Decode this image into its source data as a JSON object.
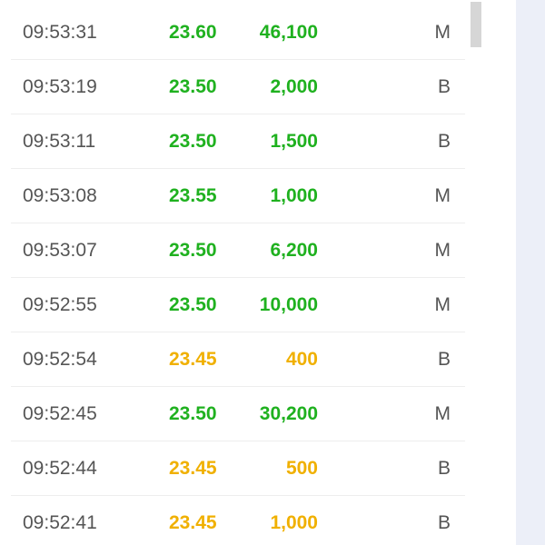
{
  "trades": [
    {
      "time": "09:53:31",
      "price": "23.60",
      "volume": "46,100",
      "side": "M",
      "trend": "up"
    },
    {
      "time": "09:53:19",
      "price": "23.50",
      "volume": "2,000",
      "side": "B",
      "trend": "up"
    },
    {
      "time": "09:53:11",
      "price": "23.50",
      "volume": "1,500",
      "side": "B",
      "trend": "up"
    },
    {
      "time": "09:53:08",
      "price": "23.55",
      "volume": "1,000",
      "side": "M",
      "trend": "up"
    },
    {
      "time": "09:53:07",
      "price": "23.50",
      "volume": "6,200",
      "side": "M",
      "trend": "up"
    },
    {
      "time": "09:52:55",
      "price": "23.50",
      "volume": "10,000",
      "side": "M",
      "trend": "up"
    },
    {
      "time": "09:52:54",
      "price": "23.45",
      "volume": "400",
      "side": "B",
      "trend": "ref"
    },
    {
      "time": "09:52:45",
      "price": "23.50",
      "volume": "30,200",
      "side": "M",
      "trend": "up"
    },
    {
      "time": "09:52:44",
      "price": "23.45",
      "volume": "500",
      "side": "B",
      "trend": "ref"
    },
    {
      "time": "09:52:41",
      "price": "23.45",
      "volume": "1,000",
      "side": "B",
      "trend": "ref"
    }
  ],
  "colors": {
    "up": "#1fb11f",
    "reference": "#f0b000",
    "text": "#555555",
    "divider": "#eeeeee",
    "side_panel": "#eceff8"
  }
}
